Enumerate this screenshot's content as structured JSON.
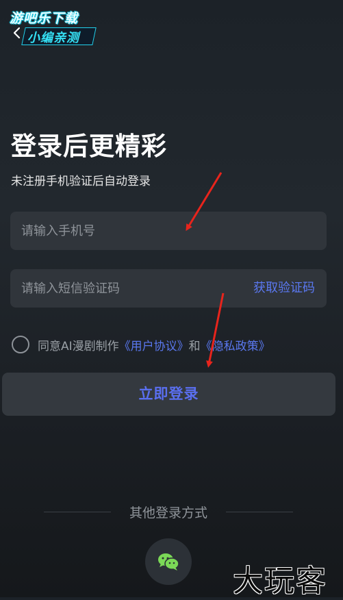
{
  "watermark": {
    "logo_line1": "游吧乐下载",
    "logo_line2": "小编亲测",
    "corner_text": "大玩客"
  },
  "header": {
    "back_icon": "chevron-left-icon"
  },
  "login": {
    "title": "登录后更精彩",
    "subtitle": "未注册手机验证后自动登录",
    "phone_placeholder": "请输入手机号",
    "code_placeholder": "请输入短信验证码",
    "get_code_label": "获取验证码",
    "agree_prefix": "同意AI漫剧制作",
    "user_agreement": "《用户协议》",
    "and_text": "和",
    "privacy_policy": "《隐私政策》",
    "login_button": "立即登录",
    "other_methods": "其他登录方式",
    "wechat_icon": "wechat-icon"
  },
  "colors": {
    "accent": "#5a78f0",
    "annotation_arrow": "#e8241c",
    "field_bg": "#30353b",
    "button_bg": "#34393f"
  }
}
